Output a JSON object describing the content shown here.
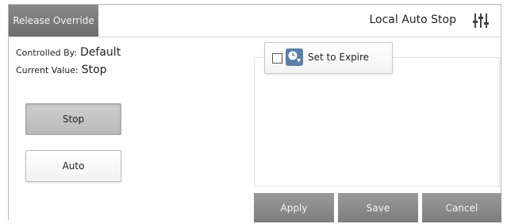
{
  "header": {
    "release_label": "Release Override",
    "title": "Local Auto Stop",
    "icon": "sliders-icon"
  },
  "info": {
    "controlled_by_label": "Controlled By:",
    "controlled_by_value": "Default",
    "current_value_label": "Current Value:",
    "current_value_value": "Stop"
  },
  "options": {
    "stop_label": "Stop",
    "auto_label": "Auto",
    "selected": "Stop"
  },
  "expire": {
    "label": "Set to Expire",
    "checked": false,
    "icon": "clock-icon"
  },
  "actions": {
    "apply_label": "Apply",
    "save_label": "Save",
    "cancel_label": "Cancel"
  },
  "colors": {
    "button_dark": "#7d7d7d",
    "accent_icon": "#5b7fa8"
  }
}
